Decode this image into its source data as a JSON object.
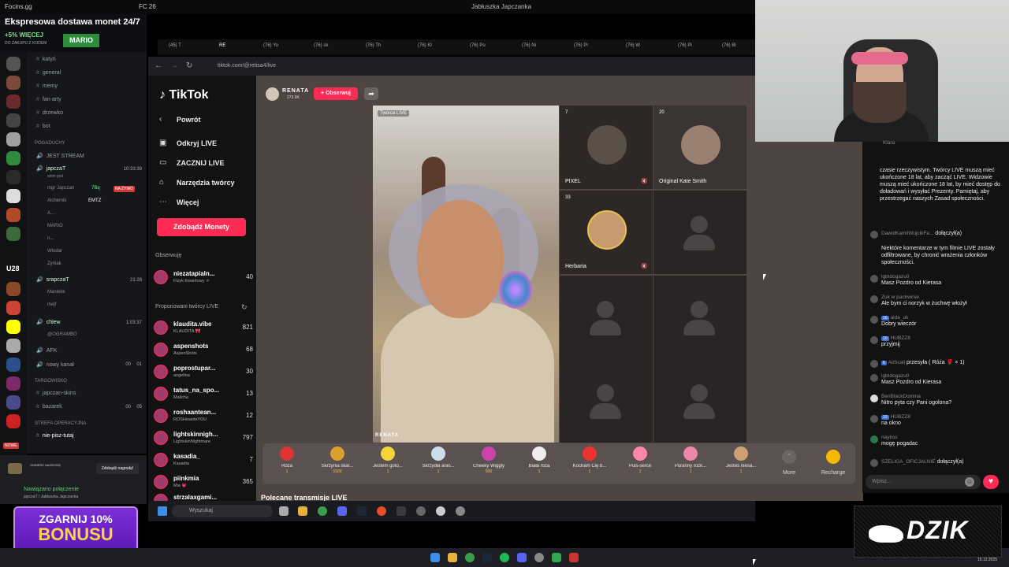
{
  "overlay": {
    "brand": "Focins.gg",
    "fc": "FC 26",
    "window_title": "Jabłuszka Japczanka",
    "promo_headline": "Ekspresowa dostawa monet 24/7",
    "promo_percent": "+5% WIĘCEJ",
    "promo_sub": "DO ZAKUPU Z KODEM",
    "promo_code": "MARIO"
  },
  "discord": {
    "channels": [
      {
        "name": "katyń"
      },
      {
        "name": "general"
      },
      {
        "name": "memy"
      },
      {
        "name": "fan-arty"
      },
      {
        "name": "drzewko"
      },
      {
        "name": "bot"
      }
    ],
    "category_pogaduchy": "POGADUCHY",
    "jest_stream": "JEST STREAM",
    "voice_japczat": {
      "name": "japczaT",
      "time": "10:33:39",
      "sub": "strim jest"
    },
    "voice_members": [
      "mgr Japczan",
      "Alchemik",
      "A...",
      "MARIO",
      "n...",
      "Włodar",
      "Zyniak"
    ],
    "badge_live": "NA ŻYWO",
    "member_tag1": "7Bq",
    "member_tag2": "EMTZ",
    "voice_srapcza": {
      "name": "srapczaT",
      "time": "21:28"
    },
    "srapcza_members": [
      "Manlekk",
      "mejf"
    ],
    "voice_chlew": {
      "name": "chlew",
      "time": "1:03:37"
    },
    "chlew_members": [
      "@OGRAMBO"
    ],
    "afk": "AFK",
    "nowy_kanal": "nowy kanał",
    "count_nowy": "00",
    "count_nowy2": "01",
    "category_targowisko": "TARGOWISKO",
    "japczan_skins": "japczan-skins",
    "bazarek": "bazarek",
    "count_baz": "00",
    "count_baz2": "05",
    "category_strefa": "STREFA OPERACYJNA",
    "nie_pisz": "nie-pisz-tutaj",
    "u28": "U28",
    "nowe": "NOWE",
    "voice_status": "Nawiązano połączenie",
    "voice_sub": "japczaT / Jabłuszka Japczanka",
    "reward": "Zdobądź nagrodę!",
    "reward_small": "ODBIERZ NAGRODĘ",
    "bonus_line1": "ZGARNIJ 10%",
    "bonus_line2": "BONUSU"
  },
  "browser": {
    "tabs": [
      "(45) T",
      "RE",
      "(76) Yo",
      "(76) sk",
      "(76) Th",
      "(76) Kl",
      "(76) Po",
      "(76) Ni",
      "(76) Pr",
      "(76) W",
      "(76) Pl",
      "(76) Bi"
    ],
    "url": "tiktok.com/@retisa4/live"
  },
  "tiktok": {
    "logo": "TikTok",
    "nav": [
      "Powrót",
      "Odkryj LIVE",
      "ZACZNIJ LIVE",
      "Narzędzia twórcy",
      "Więcej"
    ],
    "coins_button": "Zdobądź Monety",
    "following_title": "Obserwuję",
    "following": [
      {
        "name": "niezatapialn...",
        "desc": "Fizyk Kwantowy ⚛",
        "count": "40"
      }
    ],
    "suggested_title": "Proponowani twórcy LIVE",
    "suggested": [
      {
        "name": "klaudita.vibe",
        "desc": "KLAUDITA 🎀",
        "count": "821"
      },
      {
        "name": "aspenshots",
        "desc": "AspenShots",
        "count": "68"
      },
      {
        "name": "poprostupar...",
        "desc": "angelina",
        "count": "30"
      },
      {
        "name": "tatus_na_spo...",
        "desc": "Malicha",
        "count": "13"
      },
      {
        "name": "roshaantean...",
        "desc": "ROSHwantsYOU",
        "count": "12"
      },
      {
        "name": "lightskinnigh...",
        "desc": "LightskinNightmare",
        "count": "797"
      },
      {
        "name": "kasadia_",
        "desc": "Kasadia",
        "count": "7"
      },
      {
        "name": "piinkmia",
        "desc": "Mia 💗",
        "count": "365"
      },
      {
        "name": "strzalaxgami...",
        "desc": "",
        "count": ""
      }
    ],
    "host_name": "RENATA",
    "host_likes": "273.9K",
    "follow_label": "+ Obserwuj",
    "host_label": "Twórca LIVE",
    "watermark": "RENATA",
    "guests": [
      {
        "num": "7",
        "name": "PIXEL"
      },
      {
        "num": "20",
        "name": "Original Kate Smith"
      },
      {
        "num": "33",
        "name": "Herbaria"
      }
    ],
    "gifts": [
      {
        "name": "Róża",
        "price": "1"
      },
      {
        "name": "Skrzynia skar...",
        "price": "1500"
      },
      {
        "name": "Jestem goto...",
        "price": "1"
      },
      {
        "name": "Skrzydła anio...",
        "price": "1"
      },
      {
        "name": "Cheeky Wiggly",
        "price": "500"
      },
      {
        "name": "Biała róża",
        "price": "1"
      },
      {
        "name": "Kocham Cię b...",
        "price": "1"
      },
      {
        "name": "Puls-serce",
        "price": "1"
      },
      {
        "name": "Poranny rozk...",
        "price": "1"
      },
      {
        "name": "Jesteś niesa...",
        "price": "1"
      }
    ],
    "more_label": "More",
    "recharge_label": "Recharge",
    "recommended": "Polecane transmisje LIVE"
  },
  "chat": {
    "top_user": "Klara",
    "messages": [
      {
        "user": "",
        "text": "czasie rzeczywistym. Twórcy LIVE muszą mieć ukończone 18 lat, aby zacząć LIVE. Widzowie muszą mieć ukończone 18 lat, by mieć dostęp do doładowań i wysyłać Prezenty. Pamiętaj, aby przestrzegać naszych Zasad społeczności."
      },
      {
        "user": "DawidKamilWujcikFa...",
        "text": "dołączył(a)"
      },
      {
        "user": "",
        "text": "Niektóre komentarze w tym filmie LIVE zostały odfiltrowane, by chronić wrażenia członków społeczności."
      },
      {
        "user": "lgbtdogazu0",
        "text": "Masz Pozdro od Kierasa"
      },
      {
        "user": "Zuk w pachwinie",
        "text": "Ale bym ci norzyk w żuchwę włożył"
      },
      {
        "user": "aida_uk",
        "badge": "16",
        "text": "Dobry wieczór"
      },
      {
        "user": "HUBZZ8",
        "badge": "10",
        "text": "przyjmij"
      },
      {
        "user": "AliScali",
        "badge": "6",
        "text": "przesyła ( Róża 🌹 × 1)"
      },
      {
        "user": "lgbtdogazu0",
        "text": "Masz Pozdro od Kierasa"
      },
      {
        "user": "BenBlackDomina",
        "text": "Nitro pyta czy Pani ogolona?"
      },
      {
        "user": "HUBZZ8",
        "badge": "10",
        "text": "na okno"
      },
      {
        "user": "naykos",
        "text": "mogę pogadac"
      },
      {
        "user": "SZELIGA_OFICJALNIE",
        "text": "dołączył(a)"
      }
    ],
    "input_placeholder": "Wpisz..."
  },
  "taskbar": {
    "search_placeholder": "Wyszukaj",
    "date": "15.12.2025"
  },
  "sponsor": "DZIK"
}
